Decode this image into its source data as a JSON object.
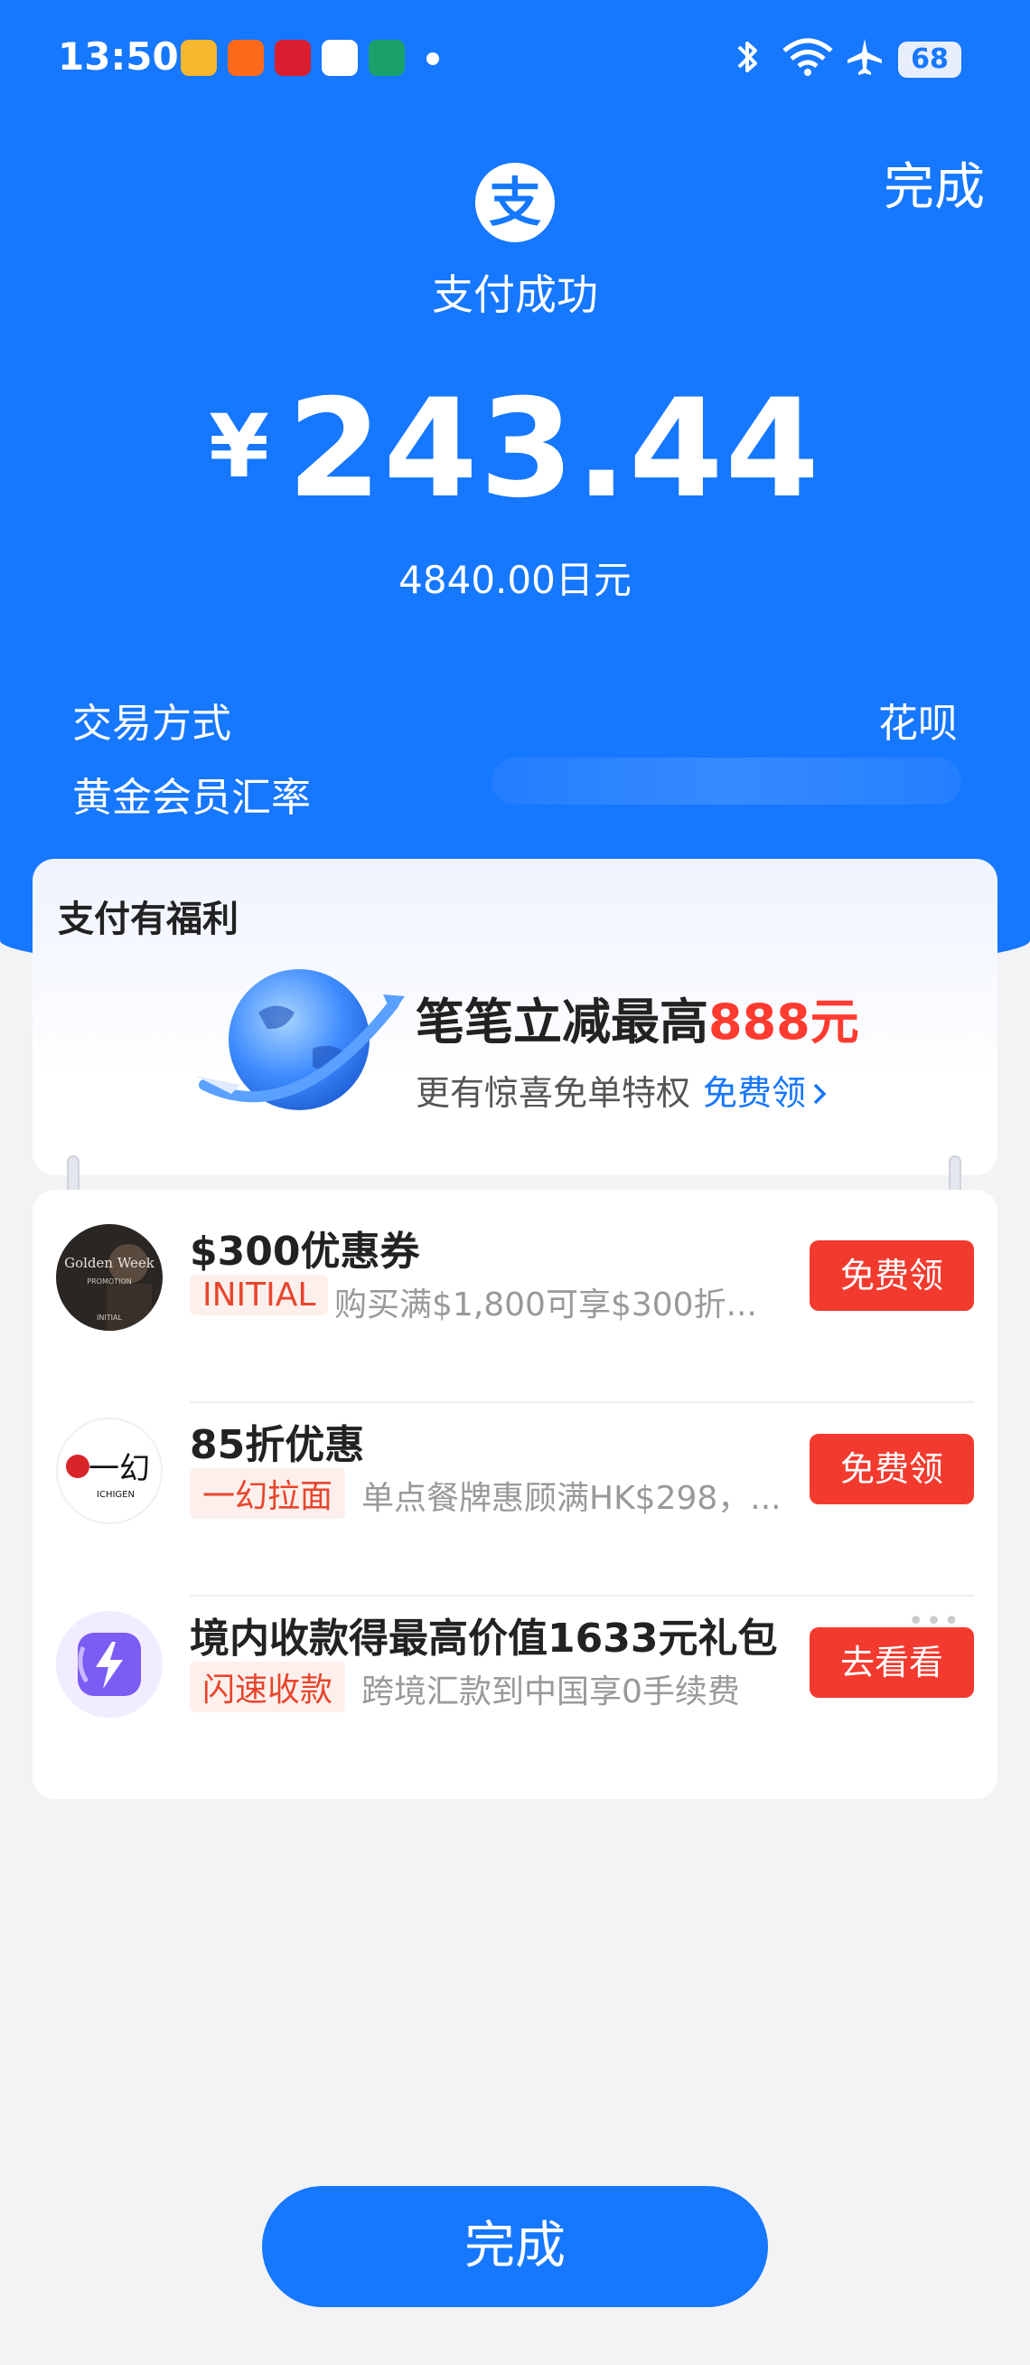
{
  "status_bar": {
    "time": "13:50",
    "battery": "68"
  },
  "header": {
    "done_label": "完成",
    "logo_glyph": "支",
    "status_text": "支付成功",
    "currency_symbol": "¥",
    "amount": "243.44",
    "original_amount": "4840.00日元"
  },
  "details": {
    "method_label": "交易方式",
    "method_value": "花呗",
    "rate_label": "黄金会员汇率"
  },
  "benefit": {
    "title": "支付有福利",
    "headline_prefix": "笔笔立减最高",
    "headline_highlight": "888元",
    "desc": "更有惊喜免单特权",
    "link": "免费领"
  },
  "offers": [
    {
      "name": "$300优惠券",
      "tag": "INITIAL",
      "info": "购买满$1,800可享$300折...",
      "button": "免费领",
      "avatar_text": "Golden Week",
      "avatar_sub": "PROMOTION",
      "avatar_brand": "INITIAL"
    },
    {
      "name": "85折优惠",
      "tag": "一幻拉面",
      "info": "单点餐牌惠顾满HK$298，...",
      "button": "免费领",
      "avatar_text": "一幻",
      "avatar_sub": "ICHIGEN"
    },
    {
      "name": "境内收款得最高价值1633元礼包",
      "tag": "闪速收款",
      "info": "跨境汇款到中国享0手续费",
      "button": "去看看"
    }
  ],
  "more_dots": "•••",
  "bottom_button": "完成",
  "colors": {
    "primary_blue": "#1677ff",
    "accent_red": "#f33a2e",
    "background": "#f3f3f5"
  }
}
